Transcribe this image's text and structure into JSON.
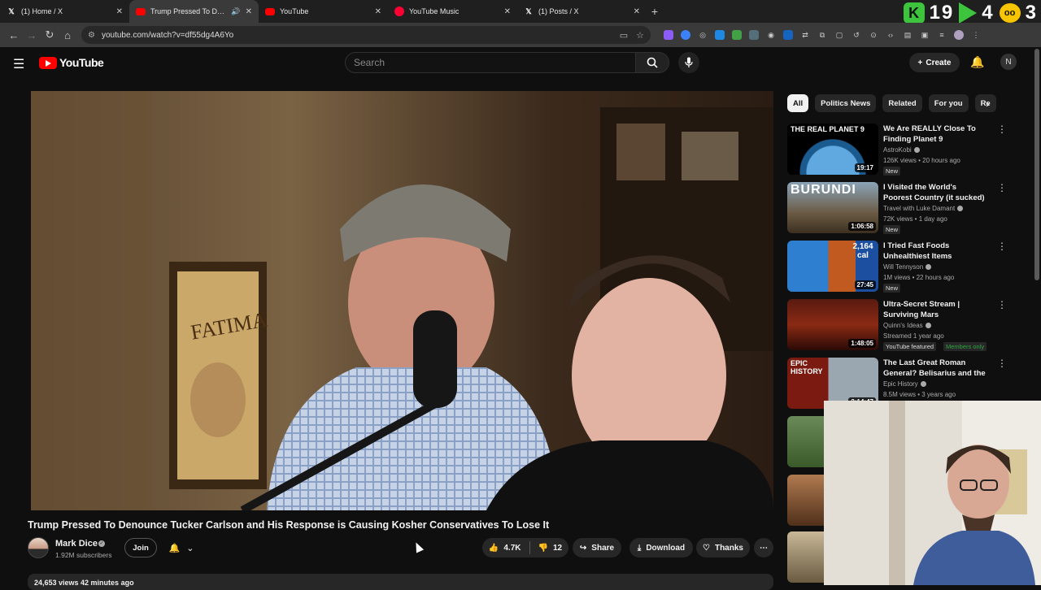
{
  "browser": {
    "tabs": [
      {
        "title": "(1) Home / X",
        "favicon": "x-icon"
      },
      {
        "title": "Trump Pressed To Denounce",
        "favicon": "youtube-icon",
        "active": true,
        "audio": true
      },
      {
        "title": "YouTube",
        "favicon": "youtube-icon"
      },
      {
        "title": "YouTube Music",
        "favicon": "youtube-music-icon"
      },
      {
        "title": "(1) Posts / X",
        "favicon": "x-icon"
      }
    ],
    "url": "youtube.com/watch?v=df55dg4A6Yo"
  },
  "overlay": {
    "k_label": "K",
    "counter1": "19",
    "counter2": "4",
    "counter3": "3",
    "face_label": "oo"
  },
  "header": {
    "logo_text": "YouTube",
    "search_placeholder": "Search",
    "create_label": "Create",
    "avatar_initial": "N"
  },
  "video": {
    "title": "Trump Pressed To Denounce Tucker Carlson and His Response is Causing Kosher Conservatives To Lose It",
    "channel_name": "Mark Dice",
    "subscribers": "1.92M subscribers",
    "join_label": "Join",
    "likes": "4.7K",
    "dislikes": "12",
    "share_label": "Share",
    "download_label": "Download",
    "thanks_label": "Thanks",
    "meta_line": "24,653 views  42 minutes ago"
  },
  "chips": [
    "All",
    "Politics News",
    "Related",
    "For you",
    "Re"
  ],
  "recommendations": [
    {
      "title": "We Are REALLY Close To Finding Planet 9",
      "channel": "AstroKobi",
      "meta": "126K views • 20 hours ago",
      "badge": "New",
      "duration": "19:17",
      "thumb_text": "THE REAL PLANET 9"
    },
    {
      "title": "I Visited the World's Poorest Country (it sucked) 🇧🇮",
      "channel": "Travel with Luke Damant",
      "meta": "72K views • 1 day ago",
      "badge": "New",
      "duration": "1:06:58",
      "thumb_text": "BURUNDI"
    },
    {
      "title": "I Tried Fast Foods Unhealthiest Items",
      "channel": "Will Tennyson",
      "meta": "1M views • 22 hours ago",
      "badge": "New",
      "duration": "27:45",
      "thumb_text": "2,164 cal"
    },
    {
      "title": "Ultra-Secret Stream | Surviving Mars",
      "channel": "Quinn's Ideas",
      "meta": "Streamed 1 year ago",
      "badge": "YouTube featured",
      "badge2": "Members only",
      "duration": "1:48:05",
      "thumb_text": ""
    },
    {
      "title": "The Last Great Roman General? Belisarius and the Wars of ...",
      "channel": "Epic History",
      "meta": "8.5M views • 3 years ago",
      "duration": "2:14:47",
      "thumb_text": "EPIC HISTORY"
    }
  ],
  "colors": {
    "background": "#0f0f0f",
    "accent_red": "#ff0000",
    "chip_bg": "#272727",
    "overlay_green": "#3cc43c"
  }
}
